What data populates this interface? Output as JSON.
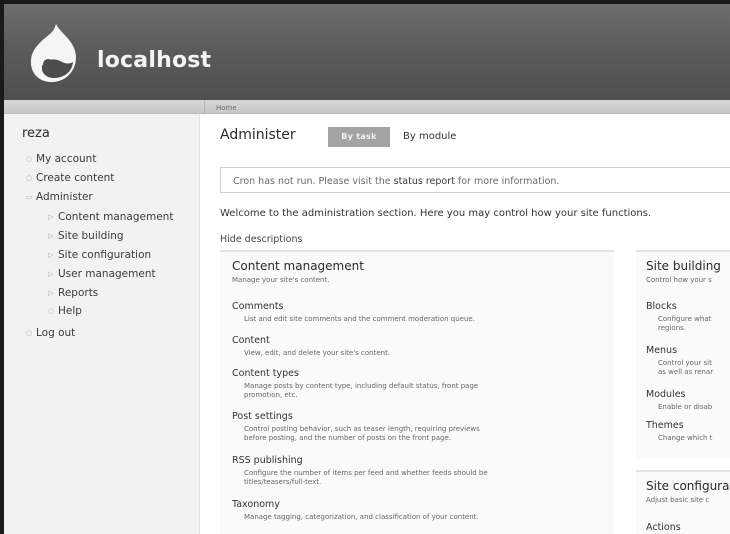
{
  "site": {
    "name": "localhost"
  },
  "breadcrumb": "Home",
  "sidebar": {
    "user": "reza",
    "items": [
      {
        "label": "My account"
      },
      {
        "label": "Create content"
      },
      {
        "label": "Administer"
      },
      {
        "label": "Content management"
      },
      {
        "label": "Site building"
      },
      {
        "label": "Site configuration"
      },
      {
        "label": "User management"
      },
      {
        "label": "Reports"
      },
      {
        "label": "Help"
      },
      {
        "label": "Log out"
      }
    ]
  },
  "main": {
    "title": "Administer",
    "tabs": [
      {
        "label": "By task"
      },
      {
        "label": "By module"
      }
    ],
    "message": {
      "before": "Cron has not run. Please visit the ",
      "link": "status report",
      "after": " for more information."
    },
    "welcome": "Welcome to the administration section. Here you may control how your site functions.",
    "hide_descriptions": "Hide descriptions"
  },
  "panels": {
    "content_management": {
      "title": "Content management",
      "desc": "Manage your site's content.",
      "items": [
        {
          "title": "Comments",
          "desc": [
            "List and edit site comments and the comment moderation queue."
          ]
        },
        {
          "title": "Content",
          "desc": [
            "View, edit, and delete your site's content."
          ]
        },
        {
          "title": "Content types",
          "desc": [
            "Manage posts by content type, including default status, front page",
            "promotion, etc."
          ]
        },
        {
          "title": "Post settings",
          "desc": [
            "Control posting behavior, such as teaser length, requiring previews",
            "before posting, and the number of posts on the front page."
          ]
        },
        {
          "title": "RSS publishing",
          "desc": [
            "Configure the number of items per feed and whether feeds should be",
            "titles/teasers/full-text."
          ]
        },
        {
          "title": "Taxonomy",
          "desc": [
            "Manage tagging, categorization, and classification of your content."
          ]
        }
      ]
    },
    "site_building": {
      "title": "Site building",
      "desc": "Control how your s",
      "items": [
        {
          "title": "Blocks",
          "desc": [
            "Configure what",
            "regions."
          ]
        },
        {
          "title": "Menus",
          "desc": [
            "Control your sit",
            "as well as renar"
          ]
        },
        {
          "title": "Modules",
          "desc": [
            "Enable or disab"
          ]
        },
        {
          "title": "Themes",
          "desc": [
            "Change which t"
          ]
        }
      ]
    },
    "site_configuration": {
      "title": "Site configurat",
      "desc": "Adjust basic site c",
      "items": [
        {
          "title": "Actions"
        }
      ]
    }
  },
  "colors": {
    "header": "#5c5c5c",
    "tab_active": "#a3a3a3",
    "sidebar": "#f2f2f2"
  }
}
